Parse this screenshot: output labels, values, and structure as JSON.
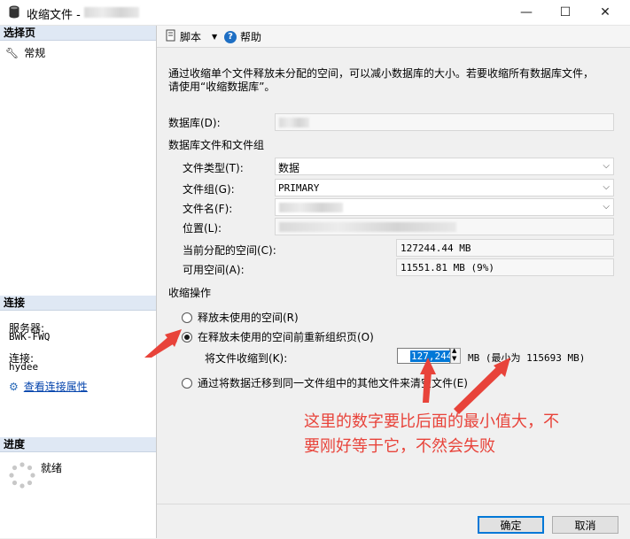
{
  "window": {
    "title": "收缩文件 -",
    "controls": {
      "minimize": "—",
      "maximize": "☐",
      "close": "✕"
    }
  },
  "left_panel": {
    "select_page_header": "选择页",
    "pages": [
      {
        "label": "常规"
      }
    ],
    "connection_header": "连接",
    "server_label": "服务器:",
    "server_value": "BWK-FWQ",
    "connection_label": "连接:",
    "connection_value": "hydee",
    "view_connection_link": "查看连接属性",
    "progress_header": "进度",
    "progress_status": "就绪"
  },
  "toolbar": {
    "script_label": "脚本",
    "help_label": "帮助"
  },
  "main": {
    "description_line1": "通过收缩单个文件释放未分配的空间，可以减小数据库的大小。若要收缩所有数据库文件，",
    "description_line2": "请使用“收缩数据库”。",
    "database_label": "数据库(D):",
    "files_group_label": "数据库文件和文件组",
    "file_type_label": "文件类型(T):",
    "file_type_value": "数据",
    "filegroup_label": "文件组(G):",
    "filegroup_value": "PRIMARY",
    "filename_label": "文件名(F):",
    "location_label": "位置(L):",
    "allocated_label": "当前分配的空间(C):",
    "allocated_value": "127244.44 MB",
    "free_label": "可用空间(A):",
    "free_value": "11551.81 MB (9%)",
    "shrink_action_label": "收缩操作",
    "option_release": "释放未使用的空间(R)",
    "option_reorganize": "在释放未使用的空间前重新组织页(O)",
    "shrink_to_label": "将文件收缩到(K):",
    "shrink_to_value": "127,244",
    "shrink_unit_note": "MB (最小为 115693 MB)",
    "option_migrate": "通过将数据迁移到同一文件组中的其他文件来清空文件(E)"
  },
  "annotation": {
    "line1": "这里的数字要比后面的最小值大，不",
    "line2": "要刚好等于它，不然会失败",
    "color": "#e8433a"
  },
  "buttons": {
    "ok": "确定",
    "cancel": "取消"
  }
}
